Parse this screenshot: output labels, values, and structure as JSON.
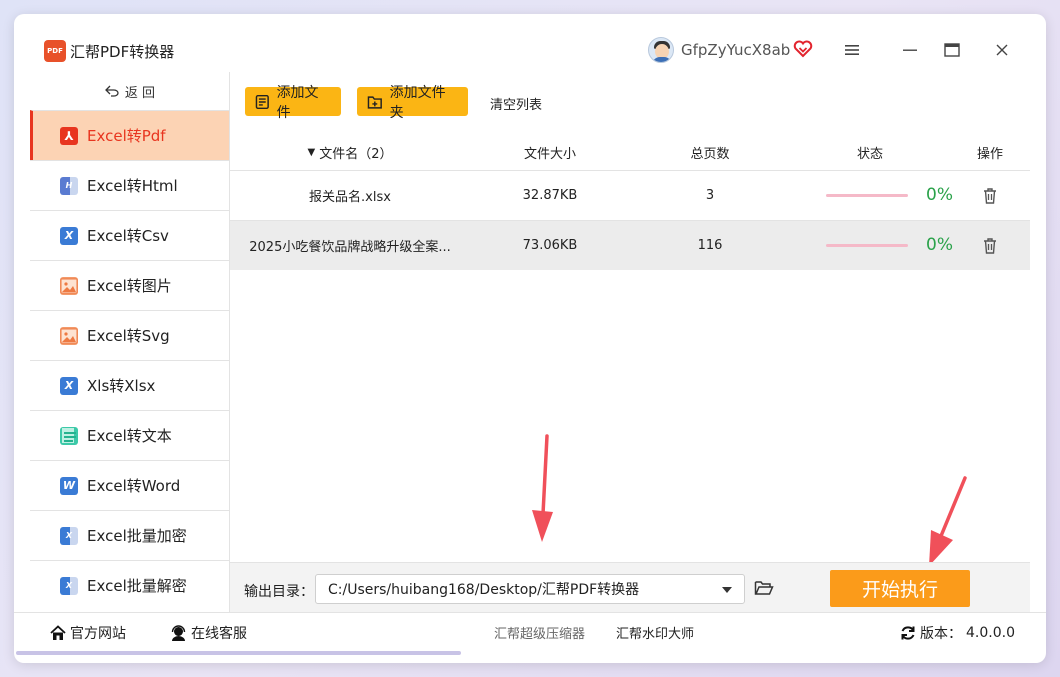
{
  "app": {
    "title": "汇帮PDF转换器",
    "logo_text": "PDF"
  },
  "user": {
    "name": "GfpZyYucX8ab"
  },
  "sidebar": {
    "back_label": "返  回",
    "items": [
      {
        "label": "Excel转Pdf",
        "icon": "pdf-icon",
        "active": true
      },
      {
        "label": "Excel转Html",
        "icon": "html-icon"
      },
      {
        "label": "Excel转Csv",
        "icon": "csv-icon"
      },
      {
        "label": "Excel转图片",
        "icon": "image-icon"
      },
      {
        "label": "Excel转Svg",
        "icon": "svg-image-icon"
      },
      {
        "label": "Xls转Xlsx",
        "icon": "xlsx-icon"
      },
      {
        "label": "Excel转文本",
        "icon": "text-icon"
      },
      {
        "label": "Excel转Word",
        "icon": "word-icon"
      },
      {
        "label": "Excel批量加密",
        "icon": "excel-lock-icon"
      },
      {
        "label": "Excel批量解密",
        "icon": "excel-unlock-icon"
      }
    ]
  },
  "toolbar": {
    "add_file": "添加文件",
    "add_folder": "添加文件夹",
    "clear_list": "清空列表"
  },
  "table": {
    "headers": {
      "name": "文件名（2）",
      "size": "文件大小",
      "pages": "总页数",
      "status": "状态",
      "ops": "操作"
    },
    "rows": [
      {
        "name": "报关品名.xlsx",
        "size": "32.87KB",
        "pages": "3",
        "progress": 0,
        "percent": "0%"
      },
      {
        "name": "2025小吃餐饮品牌战略升级全案...",
        "size": "73.06KB",
        "pages": "116",
        "progress": 0,
        "percent": "0%"
      }
    ]
  },
  "output": {
    "label": "输出目录：",
    "path": "C:/Users/huibang168/Desktop/汇帮PDF转换器",
    "start_label": "开始执行"
  },
  "footer": {
    "site": "官方网站",
    "service": "在线客服",
    "compressor": "汇帮超级压缩器",
    "watermark": "汇帮水印大师",
    "version_label": "版本：",
    "version": "4.0.0.0"
  },
  "colors": {
    "accent": "#fb9b1a",
    "toolbar_button": "#fbb514",
    "active_bg": "#fcd3b4",
    "active_text": "#e8351f",
    "percent": "#2aa24a"
  }
}
